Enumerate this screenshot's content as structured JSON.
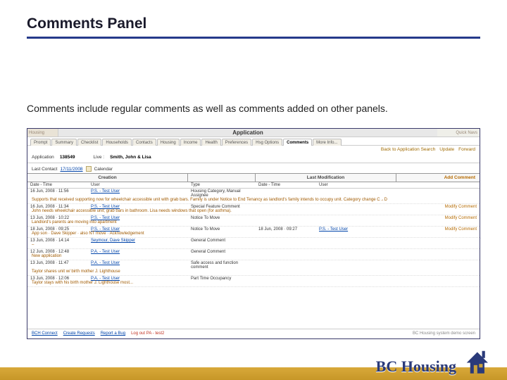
{
  "slide": {
    "title": "Comments Panel",
    "body": "Comments include regular comments as well as comments added on other panels."
  },
  "screenshot": {
    "sidebarLabel": "Housing",
    "appLabel": "Application",
    "quickNav": "Quick Navs",
    "tabs": [
      "Prompt",
      "Summary",
      "Checklist",
      "Households",
      "Contacts",
      "Housing",
      "Income",
      "Health",
      "Preferences",
      "Hsg Options",
      "Comments",
      "More Info..."
    ],
    "activeTab": "Comments",
    "rightButtons": [
      "Back to Application Search",
      "Update",
      "Forward"
    ],
    "header": {
      "appNoLabel": "Application",
      "appNo": "138549",
      "liveLabel": "Live :",
      "live": "Smith, John & Lisa"
    },
    "contact": {
      "label": "Last Contact",
      "date": "17/11/2008",
      "cal": "Calendar"
    },
    "tableHead": {
      "g1": "Creation",
      "g2": "",
      "g3": "Last Modification",
      "add": "Add Comment",
      "c_dt": "Date - Time",
      "c_usr": "User",
      "c_type": "Type",
      "m_dt": "Date - Time",
      "m_usr": "User"
    },
    "rows": [
      {
        "dt": "16 Jun, 2008 · 11:56",
        "usr": "P.S. - Test User",
        "type": "Housing Category, Manual Assignee",
        "note": "Supports that received supporting now for wheelchair accessible unit with grab bars. Family is under Notice to End Tenancy as landlord's family intends to occupy unit. Category change C→D",
        "mdt": "",
        "musr": "",
        "act": ""
      },
      {
        "dt": "16 Jun, 2008 · 11:34",
        "usr": "P.S. - Test User",
        "type": "Special Feature Comment",
        "note": "John needs wheelchair accessible unit; grab bars in bathroom. Lisa needs windows that open (for asthma).",
        "mdt": "",
        "musr": "",
        "act": "Modify Comment"
      },
      {
        "dt": "13 Jun, 2008 · 10:22",
        "usr": "P.S. - Test User",
        "type": "Notice To Move",
        "note": "Landlord's parents are moving into apartment",
        "mdt": "",
        "musr": "",
        "act": "Modify Comment"
      },
      {
        "dt": "18 Jun, 2008 · 09:25",
        "usr": "P.S. - Test User",
        "type": "Notice To Move",
        "note": "App son · Dave Skipper · also NT move · Acknowledgement",
        "mdt": "18 Jun, 2008 · 09:27",
        "musr": "P.S. - Test User",
        "act": "Modify Comment"
      },
      {
        "dt": "13 Jun, 2008 · 14:14",
        "usr": "Seymour, Dave Skipper",
        "type": "General Comment",
        "note": "–",
        "mdt": "",
        "musr": "",
        "act": ""
      },
      {
        "dt": "12 Jun, 2008 · 12:48",
        "usr": "P.A. - Test User",
        "type": "General Comment",
        "note": "New application",
        "mdt": "",
        "musr": "",
        "act": ""
      },
      {
        "dt": "13 Jun, 2008 · 11:47",
        "usr": "P.A. - Test User",
        "type": "Safe access and function comment",
        "note": "Taylor shares unit w/ birth mother J. Lighthouse",
        "mdt": "",
        "musr": "",
        "act": ""
      },
      {
        "dt": "13 Jun, 2008 · 12:06",
        "usr": "P.A. - Test User",
        "type": "Part Time Occupancy",
        "note": "Taylor stays with his birth mother J. Lighthouse most...",
        "mdt": "",
        "musr": "",
        "act": ""
      }
    ],
    "footerLinks": [
      "BCH Connect",
      "Create Requests",
      "Report a Bug"
    ],
    "footerRed": "Log out PA - test2",
    "footerNote": "BC Housing system demo screen"
  },
  "brand": {
    "name": "BC Housing"
  }
}
